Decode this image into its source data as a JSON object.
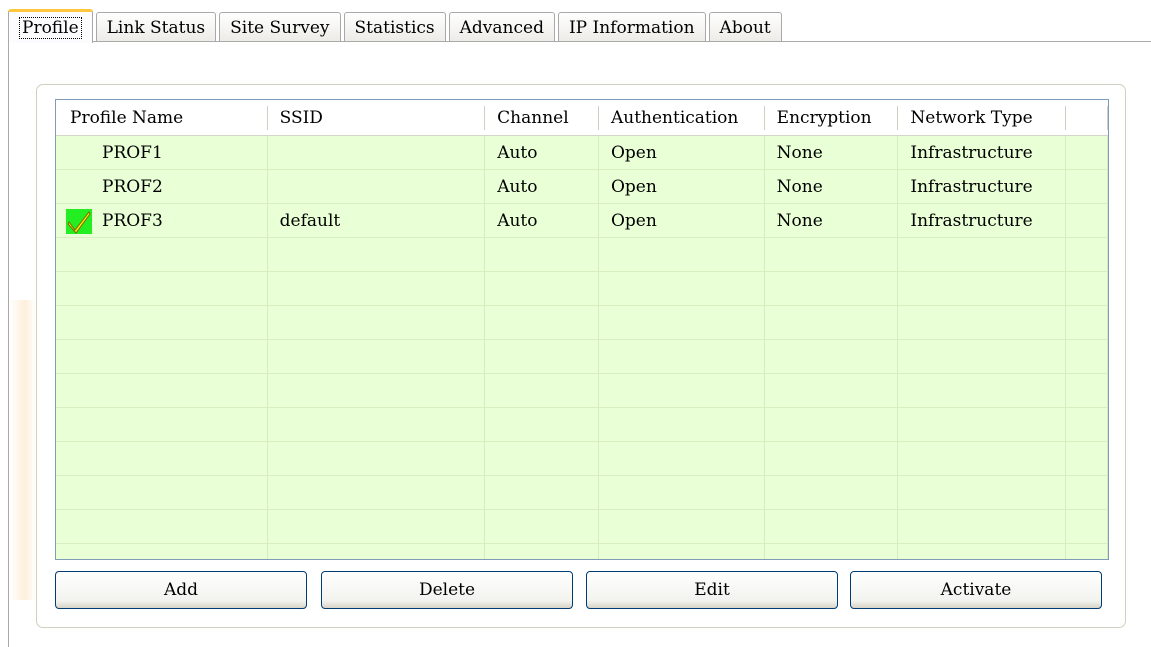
{
  "tabs": [
    {
      "label": "Profile",
      "active": true
    },
    {
      "label": "Link Status"
    },
    {
      "label": "Site Survey"
    },
    {
      "label": "Statistics"
    },
    {
      "label": "Advanced"
    },
    {
      "label": "IP Information"
    },
    {
      "label": "About"
    }
  ],
  "table": {
    "columns": [
      "Profile Name",
      "SSID",
      "Channel",
      "Authentication",
      "Encryption",
      "Network Type"
    ],
    "rows": [
      {
        "profile": "PROF1",
        "ssid": "",
        "channel": "Auto",
        "auth": "Open",
        "enc": "None",
        "type": "Infrastructure",
        "active": false
      },
      {
        "profile": "PROF2",
        "ssid": "",
        "channel": "Auto",
        "auth": "Open",
        "enc": "None",
        "type": "Infrastructure",
        "active": false
      },
      {
        "profile": "PROF3",
        "ssid": "default",
        "channel": "Auto",
        "auth": "Open",
        "enc": "None",
        "type": "Infrastructure",
        "active": true
      }
    ],
    "active_icon": "checkmark-icon"
  },
  "buttons": {
    "add": "Add",
    "delete": "Delete",
    "edit": "Edit",
    "activate": "Activate"
  },
  "colors": {
    "list_background": "#e9ffd6",
    "active_tab_accent": "#ffc83c",
    "check_background": "#22ee22",
    "check_mark": "#ffee00"
  }
}
